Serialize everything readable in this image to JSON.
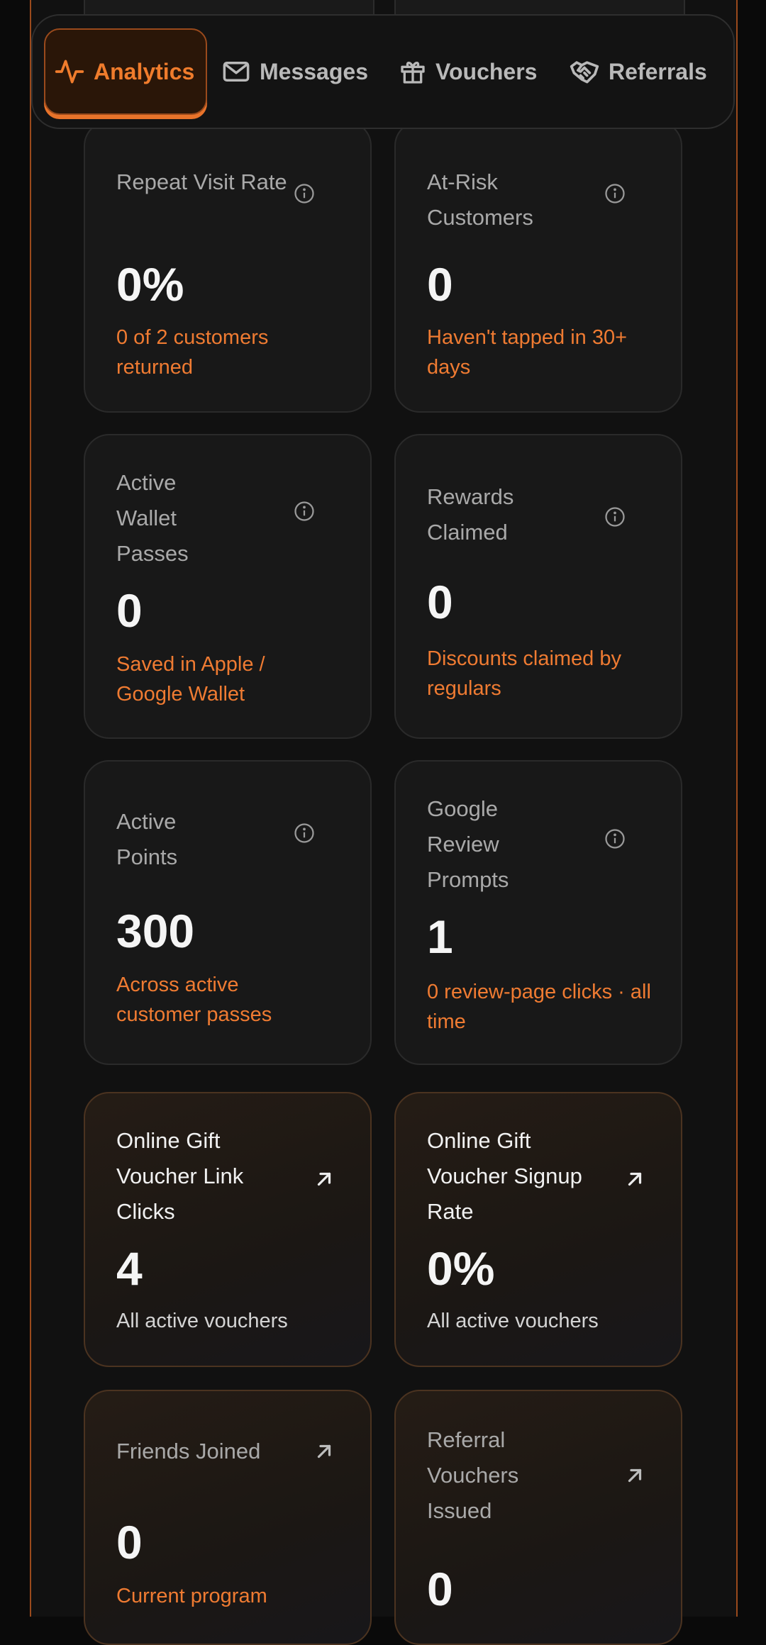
{
  "nav": {
    "tabs": [
      {
        "label": "Analytics",
        "icon": "activity-icon",
        "active": true
      },
      {
        "label": "Messages",
        "icon": "envelope-icon",
        "active": false
      },
      {
        "label": "Vouchers",
        "icon": "gift-icon",
        "active": false
      },
      {
        "label": "Referrals",
        "icon": "handshake-icon",
        "active": false
      }
    ]
  },
  "colors": {
    "accent": "#ef7b32",
    "background": "#0a0a0a",
    "card": "#181818"
  },
  "cards": {
    "repeat_visit": {
      "title": "Repeat Visit Rate",
      "value": "0%",
      "sub": "0 of 2 customers returned"
    },
    "at_risk": {
      "title": "At-Risk Customers",
      "value": "0",
      "sub": "Haven't tapped in 30+ days"
    },
    "wallet_passes": {
      "title": "Active Wallet Passes",
      "value": "0",
      "sub": "Saved in Apple / Google Wallet"
    },
    "rewards_claimed": {
      "title": "Rewards Claimed",
      "value": "0",
      "sub": "Discounts claimed by regulars"
    },
    "active_points": {
      "title": "Active Points",
      "value": "300",
      "sub": "Across active customer passes"
    },
    "review_prompts": {
      "title": "Google Review Prompts",
      "value": "1",
      "sub": "0 review-page clicks · all time"
    },
    "voucher_clicks": {
      "title": "Online Gift Voucher Link Clicks",
      "value": "4",
      "sub": "All active vouchers"
    },
    "voucher_signup": {
      "title": "Online Gift Voucher Signup Rate",
      "value": "0%",
      "sub": "All active vouchers"
    },
    "friends_joined": {
      "title": "Friends Joined",
      "value": "0",
      "sub": "Current program"
    },
    "referral_vouchers": {
      "title": "Referral Vouchers Issued",
      "value": "0",
      "sub": ""
    }
  }
}
